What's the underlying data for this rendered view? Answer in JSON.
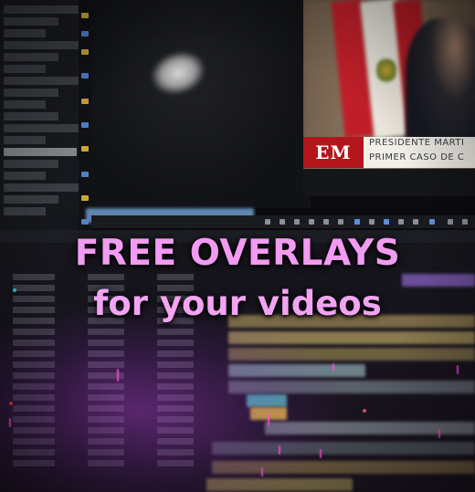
{
  "overlay": {
    "headline": "FREE OVERLAYS",
    "subline": "for your videos"
  },
  "news_video": {
    "logo_text": "EM",
    "lower_third_line1": "PRESIDENTE MARTI",
    "lower_third_line2": "PRIMER CASO DE C"
  },
  "colors": {
    "headline_pink": "#f29bf2",
    "glow_purple": "#aa3cd2",
    "news_red": "#b3161c",
    "viewer_bar_blue": "#5f86b0"
  }
}
